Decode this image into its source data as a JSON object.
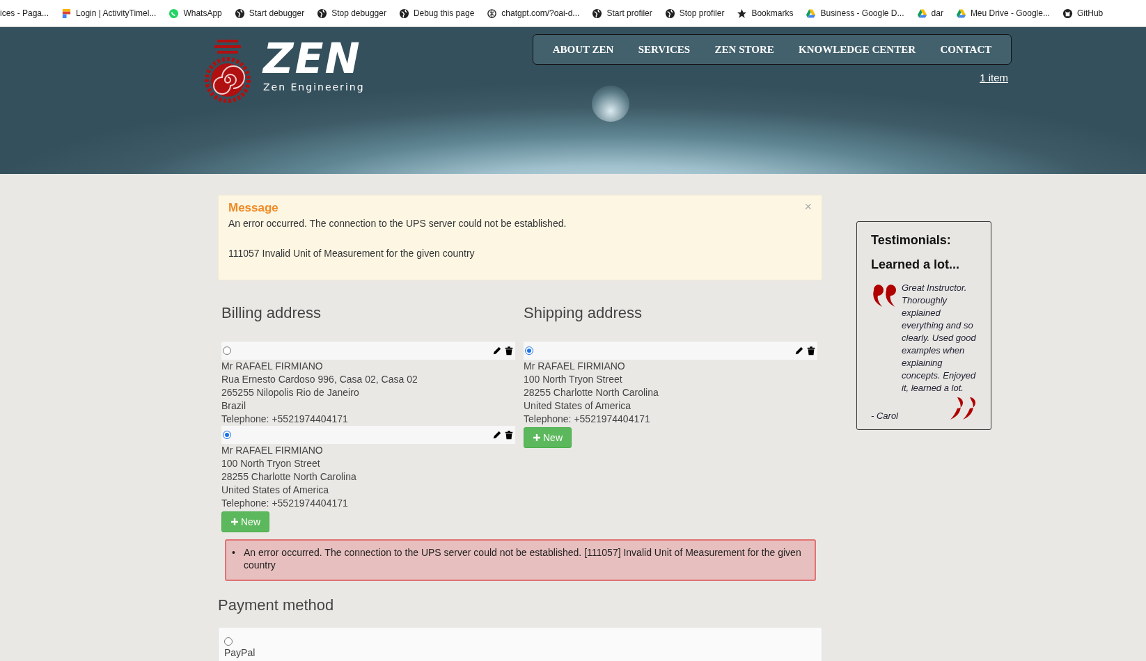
{
  "bookmarks": [
    {
      "label": "ices - Paga...",
      "kind": "none"
    },
    {
      "label": "Login | ActivityTimel...",
      "kind": "flag"
    },
    {
      "label": "WhatsApp",
      "kind": "whatsapp"
    },
    {
      "label": "Start debugger",
      "kind": "globe"
    },
    {
      "label": "Stop debugger",
      "kind": "globe"
    },
    {
      "label": "Debug this page",
      "kind": "globe"
    },
    {
      "label": "chatgpt.com/?oai-d...",
      "kind": "knot"
    },
    {
      "label": "Start profiler",
      "kind": "globe"
    },
    {
      "label": "Stop profiler",
      "kind": "globe"
    },
    {
      "label": "Bookmarks",
      "kind": "star"
    },
    {
      "label": "Business - Google D...",
      "kind": "drive"
    },
    {
      "label": "dar",
      "kind": "drive"
    },
    {
      "label": "Meu Drive - Google...",
      "kind": "drive"
    },
    {
      "label": "GitHub",
      "kind": "github"
    }
  ],
  "header": {
    "logo_title": "ZEN",
    "logo_subtitle": "Zen Engineering",
    "nav": [
      {
        "label": "ABOUT ZEN",
        "selected": false
      },
      {
        "label": "SERVICES",
        "selected": false
      },
      {
        "label": "ZEN STORE",
        "selected": false
      },
      {
        "label": "KNOWLEDGE CENTER",
        "selected": false
      },
      {
        "label": "CONTACT",
        "selected": false
      }
    ],
    "cart_link": "1 item"
  },
  "message": {
    "title": "Message",
    "close": "×",
    "lines": [
      "An error occurred. The connection to the UPS server could not be established.",
      "111057 Invalid Unit of Measurement for the given country"
    ]
  },
  "billing": {
    "heading": "Billing address",
    "new_button": "New",
    "addresses": [
      {
        "selected": false,
        "lines": [
          "Mr RAFAEL FIRMIANO",
          "Rua Ernesto Cardoso 996, Casa 02, Casa 02",
          "265255 Nilopolis Rio de Janeiro",
          "Brazil",
          "Telephone: +5521974404171"
        ]
      },
      {
        "selected": true,
        "lines": [
          "Mr RAFAEL FIRMIANO",
          "100 North Tryon Street",
          "28255 Charlotte North Carolina",
          "United States of America",
          "Telephone: +5521974404171"
        ]
      }
    ]
  },
  "shipping": {
    "heading": "Shipping address",
    "new_button": "New",
    "addresses": [
      {
        "selected": true,
        "lines": [
          "Mr RAFAEL FIRMIANO",
          "100 North Tryon Street",
          "28255 Charlotte North Carolina",
          "United States of America",
          "Telephone: +5521974404171"
        ]
      }
    ]
  },
  "errors": [
    {
      "bullet": "•",
      "text": "An error occurred. The connection to the UPS server could not be established. [111057] Invalid Unit of Measurement for the given country"
    }
  ],
  "payment": {
    "heading": "Payment method",
    "options": [
      {
        "label": "PayPal",
        "selected": false
      }
    ]
  },
  "testimonial": {
    "heading": "Testimonials:",
    "title": "Learned a lot...",
    "quote": "Great Instructor. Thoroughly explained everything and so clearly. Used good examples when explaining concepts. Enjoyed it, learned a lot.",
    "author": "- Carol"
  }
}
